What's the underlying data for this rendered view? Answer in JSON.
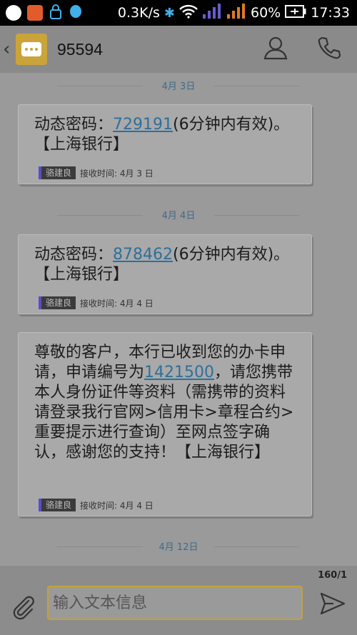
{
  "status_bar": {
    "speed": "0.3K/s",
    "battery": "60%",
    "time": "17:33"
  },
  "header": {
    "title": "95594",
    "icons": [
      "back-chevron-icon",
      "sms-app-icon",
      "contact-person-icon",
      "phone-call-icon"
    ]
  },
  "thread": {
    "messages": [
      {
        "date": "4月 3日",
        "pre": "动态密码：",
        "link": "729191",
        "post": "(6分钟内有效)。【上海银行】",
        "sim": "骆建良",
        "received": "接收时间: 4月 3 日"
      },
      {
        "date": "4月 4日",
        "pre": "动态密码：",
        "link": "878462",
        "post": "(6分钟内有效)。【上海银行】",
        "sim": "骆建良",
        "received": "接收时间: 4月 4 日"
      },
      {
        "date": "",
        "pre": "尊敬的客户，本行已收到您的办卡申请，申请编号为",
        "link": "1421500",
        "post": "，请您携带本人身份证件等资料（需携带的资料请登录我行官网>信用卡>章程合约>重要提示进行查询）至网点签字确认，感谢您的支持！【上海银行】",
        "sim": "骆建良",
        "received": "接收时间: 4月 4 日"
      }
    ],
    "last_date": "4月 12日"
  },
  "composer": {
    "counter": "160/1",
    "placeholder": "输入文本信息"
  },
  "colors": {
    "accent": "#c6a13a",
    "link": "#2f6f9a",
    "sim_badge": "#5a4fc0"
  }
}
